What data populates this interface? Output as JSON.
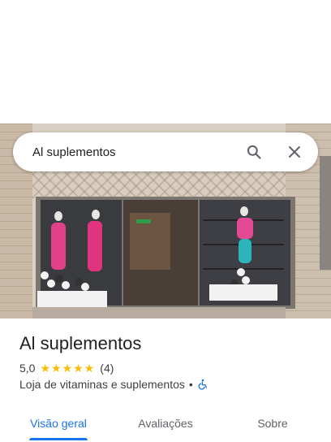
{
  "search": {
    "query": "Al suplementos"
  },
  "place": {
    "name": "Al suplementos",
    "rating": "5,0",
    "stars": 5,
    "review_count": "(4)",
    "category": "Loja de vitaminas e suplementos",
    "separator": "•"
  },
  "tabs": [
    {
      "label": "Visão geral",
      "active": true
    },
    {
      "label": "Avaliações",
      "active": false
    },
    {
      "label": "Sobre",
      "active": false
    }
  ],
  "icons": {
    "search": "search-icon",
    "close": "close-icon",
    "accessibility": "wheelchair-icon",
    "star": "star-icon"
  },
  "colors": {
    "accent": "#1a73e8",
    "star": "#fbbc04",
    "accessibility": "#1a73e8"
  }
}
